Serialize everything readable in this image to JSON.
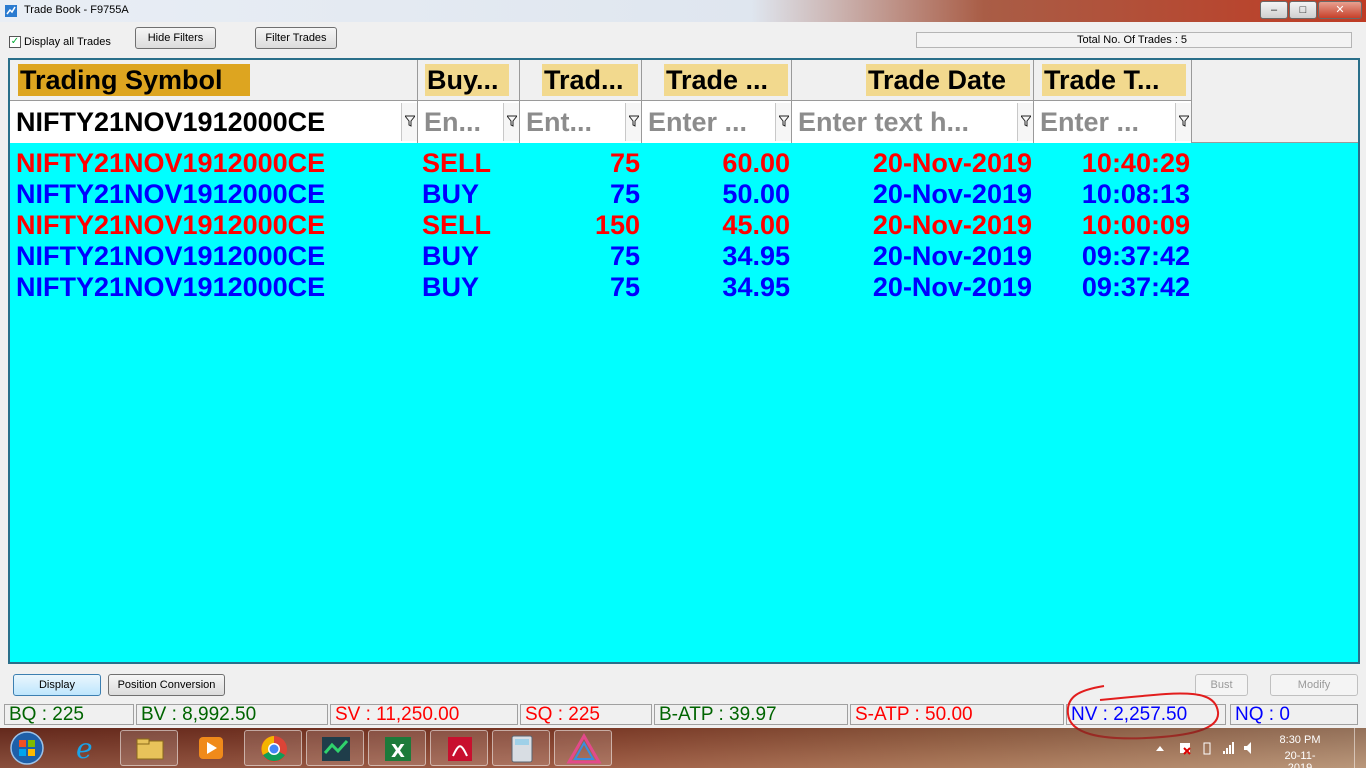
{
  "window": {
    "title": "Trade Book - F9755A",
    "buttons": {
      "minimize": "–",
      "maximize": "□",
      "close": "✕"
    }
  },
  "toolbar": {
    "display_all_label": "Display all Trades",
    "display_all_checked": true,
    "hide_filters_label": "Hide Filters",
    "filter_trades_label": "Filter Trades",
    "total_trades_text": "Total No. Of Trades : 5"
  },
  "grid": {
    "columns": [
      {
        "key": "symbol",
        "header": "Trading Symbol",
        "filter_value": "NIFTY21NOV1912000CE",
        "filter_is_value": true
      },
      {
        "key": "buysell",
        "header": "Buy...",
        "filter_value": "En...",
        "filter_is_value": false
      },
      {
        "key": "qty",
        "header": "Trad...",
        "filter_value": "Ent...",
        "filter_is_value": false
      },
      {
        "key": "price",
        "header": "Trade ...",
        "filter_value": "Enter ...",
        "filter_is_value": false
      },
      {
        "key": "date",
        "header": "Trade Date",
        "filter_value": "Enter text h...",
        "filter_is_value": false
      },
      {
        "key": "time",
        "header": "Trade T...",
        "filter_value": "Enter ...",
        "filter_is_value": false
      }
    ],
    "rows": [
      {
        "symbol": "NIFTY21NOV1912000CE",
        "buysell": "SELL",
        "qty": "75",
        "price": "60.00",
        "date": "20-Nov-2019",
        "time": "10:40:29",
        "color": "#ff0000"
      },
      {
        "symbol": "NIFTY21NOV1912000CE",
        "buysell": "BUY",
        "qty": "75",
        "price": "50.00",
        "date": "20-Nov-2019",
        "time": "10:08:13",
        "color": "#0000ff"
      },
      {
        "symbol": "NIFTY21NOV1912000CE",
        "buysell": "SELL",
        "qty": "150",
        "price": "45.00",
        "date": "20-Nov-2019",
        "time": "10:00:09",
        "color": "#ff0000"
      },
      {
        "symbol": "NIFTY21NOV1912000CE",
        "buysell": "BUY",
        "qty": "75",
        "price": "34.95",
        "date": "20-Nov-2019",
        "time": "09:37:42",
        "color": "#0000ff"
      },
      {
        "symbol": "NIFTY21NOV1912000CE",
        "buysell": "BUY",
        "qty": "75",
        "price": "34.95",
        "date": "20-Nov-2019",
        "time": "09:37:42",
        "color": "#0000ff"
      }
    ]
  },
  "bottom": {
    "display_label": "Display",
    "position_conversion_label": "Position Conversion",
    "bust_label": "Bust",
    "modify_label": "Modify"
  },
  "status": {
    "bq": "BQ : 225",
    "bv": "BV : 8,992.50",
    "sv": "SV : 11,250.00",
    "sq": "SQ : 225",
    "batp": "B-ATP : 39.97",
    "satp": "S-ATP : 50.00",
    "nv": "NV : 2,257.50",
    "nq": "NQ : 0"
  },
  "taskbar": {
    "time": "8:30 PM",
    "date": "20-11-2019",
    "apps": [
      "ie-icon",
      "explorer-icon",
      "media-player-icon",
      "chrome-icon",
      "trading-app-icon",
      "excel-icon",
      "acrobat-icon",
      "calculator-icon",
      "triangle-app-icon"
    ]
  },
  "colors": {
    "grid_bg": "#00ffff",
    "sell": "#ff0000",
    "buy": "#0000ff",
    "header_label_bg": "#f2d98e",
    "symbol_header_bg": "#dda520",
    "status_green": "#006400",
    "annotation": "#e21d1d"
  }
}
